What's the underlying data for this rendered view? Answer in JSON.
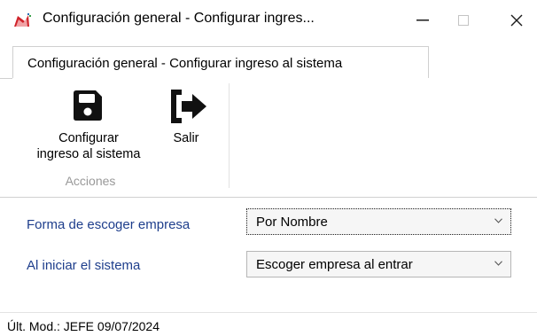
{
  "window": {
    "title": "Configuración general - Configurar ingres...",
    "controls": {
      "minimize_icon": "minimize-icon",
      "maximize_icon": "maximize-icon",
      "close_icon": "close-icon"
    }
  },
  "ribbon": {
    "tab_label": "Configuración general - Configurar ingreso al sistema",
    "buttons": [
      {
        "label_line1": "Configurar",
        "label_line2": "ingreso al sistema",
        "icon": "save-icon"
      },
      {
        "label": "Salir",
        "icon": "exit-icon"
      }
    ],
    "group_label": "Acciones"
  },
  "form": {
    "fields": [
      {
        "label": "Forma de escoger empresa",
        "value": "Por Nombre"
      },
      {
        "label": "Al iniciar el sistema",
        "value": "Escoger empresa al entrar"
      }
    ]
  },
  "status": {
    "text": "Últ. Mod.:  JEFE  09/07/2024"
  },
  "colors": {
    "label_text": "#1e3e8c",
    "group_label_text": "#999999",
    "app_icon_red": "#d0242b"
  }
}
